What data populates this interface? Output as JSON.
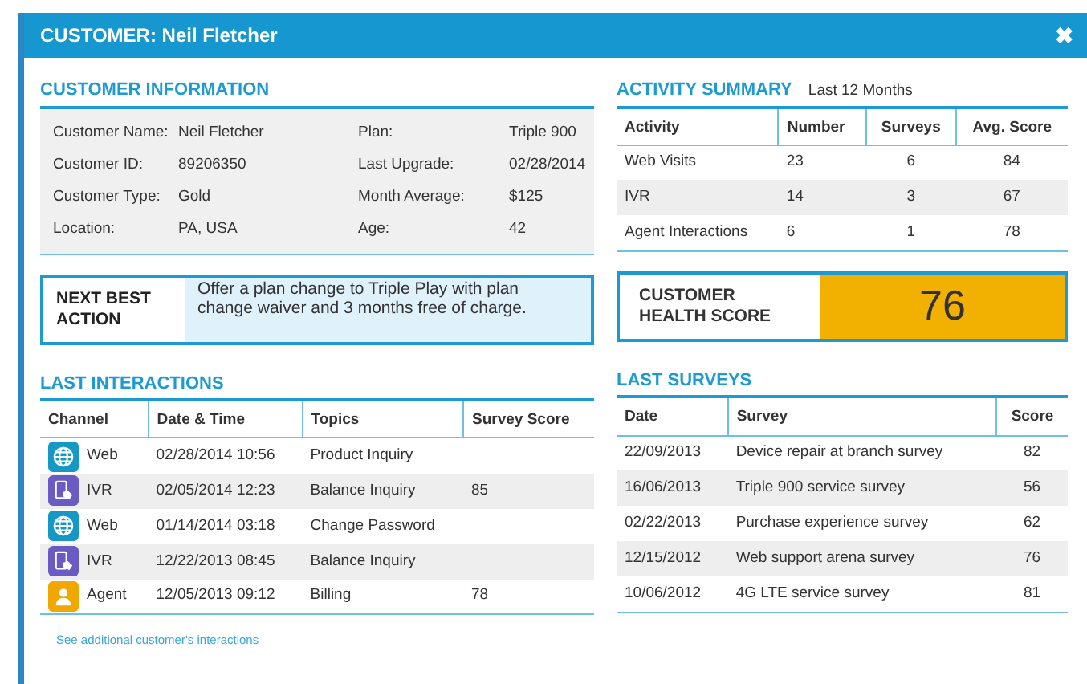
{
  "window": {
    "title": "CUSTOMER: Neil Fletcher",
    "close": "✖"
  },
  "customer_information": {
    "title": "CUSTOMER INFORMATION",
    "fields": [
      {
        "label": "Customer Name:",
        "value": "Neil Fletcher"
      },
      {
        "label": "Plan:",
        "value": "Triple 900"
      },
      {
        "label": "Customer ID:",
        "value": "89206350"
      },
      {
        "label": "Last Upgrade:",
        "value": "02/28/2014"
      },
      {
        "label": "Customer Type:",
        "value": "Gold"
      },
      {
        "label": "Month Average:",
        "value": "$125"
      },
      {
        "label": "Location:",
        "value": "PA, USA"
      },
      {
        "label": "Age:",
        "value": "42"
      }
    ]
  },
  "next_best_action": {
    "label": "NEXT BEST ACTION",
    "text": "Offer a plan change to Triple Play with plan change waiver and 3 months free of charge."
  },
  "activity_summary": {
    "title": "ACTIVITY SUMMARY",
    "subtitle": "Last 12 Months",
    "columns": [
      "Activity",
      "Number",
      "Surveys",
      "Avg. Score"
    ],
    "rows": [
      [
        "Web Visits",
        "23",
        "6",
        "84"
      ],
      [
        "IVR",
        "14",
        "3",
        "67"
      ],
      [
        "Agent Interactions",
        "6",
        "1",
        "78"
      ]
    ]
  },
  "health_score": {
    "label": "CUSTOMER HEALTH SCORE",
    "value": "76",
    "color": "#f2b100"
  },
  "last_interactions": {
    "title": "LAST INTERACTIONS",
    "columns": [
      "Channel",
      "Date & Time",
      "Topics",
      "Survey Score"
    ],
    "rows": [
      {
        "kind": "web",
        "channel": "Web",
        "datetime": "02/28/2014 10:56",
        "topic": "Product Inquiry",
        "score": ""
      },
      {
        "kind": "ivr",
        "channel": "IVR",
        "datetime": "02/05/2014 12:23",
        "topic": "Balance Inquiry",
        "score": "85"
      },
      {
        "kind": "web",
        "channel": "Web",
        "datetime": "01/14/2014 03:18",
        "topic": "Change Password",
        "score": ""
      },
      {
        "kind": "ivr",
        "channel": "IVR",
        "datetime": "12/22/2013 08:45",
        "topic": "Balance Inquiry",
        "score": ""
      },
      {
        "kind": "agent",
        "channel": "Agent",
        "datetime": "12/05/2013 09:12",
        "topic": "Billing",
        "score": "78"
      }
    ],
    "link": "See additional customer's interactions"
  },
  "last_surveys": {
    "title": "LAST SURVEYS",
    "columns": [
      "Date",
      "Survey",
      "Score"
    ],
    "rows": [
      [
        "22/09/2013",
        "Device repair at branch survey",
        "82"
      ],
      [
        "16/06/2013",
        "Triple 900 service survey",
        "56"
      ],
      [
        "02/22/2013",
        "Purchase experience survey",
        "62"
      ],
      [
        "12/15/2012",
        "Web support arena survey",
        "76"
      ],
      [
        "10/06/2012",
        "4G LTE service survey",
        "81"
      ]
    ]
  }
}
